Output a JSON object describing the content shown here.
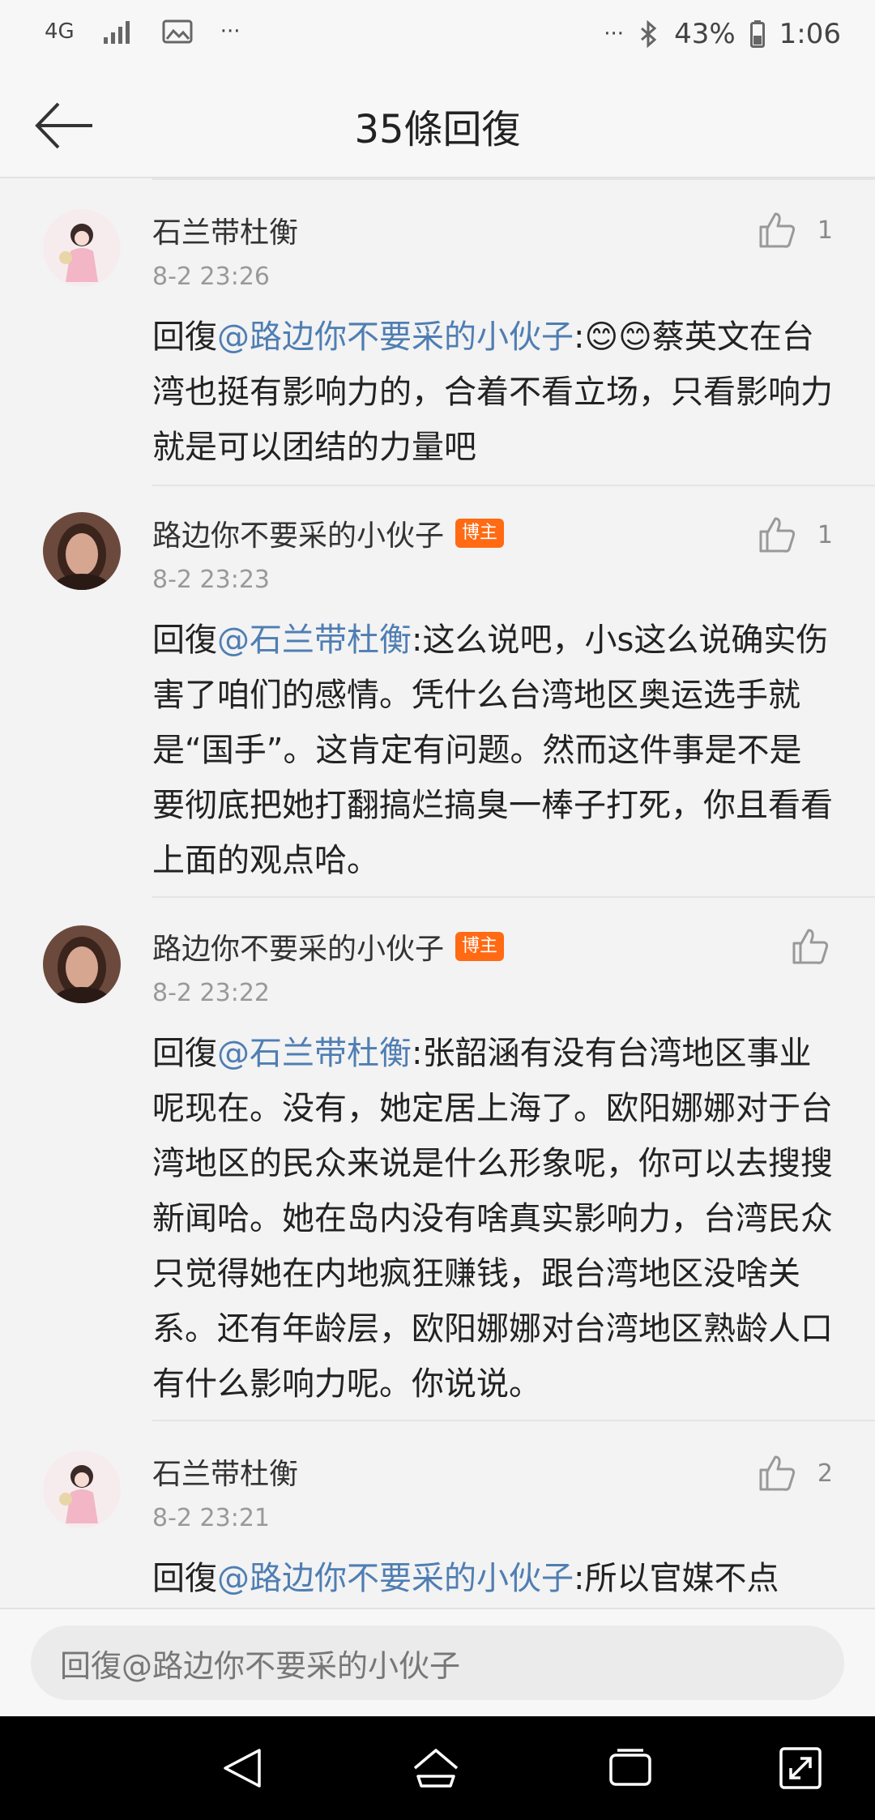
{
  "status_bar": {
    "network": "4G",
    "battery": "43%",
    "time": "1:06",
    "more": "···"
  },
  "header": {
    "title": "35條回復"
  },
  "comments": [
    {
      "author": "石兰带杜衡",
      "badge": "",
      "time": "8-2 23:26",
      "likes": "1",
      "reply_prefix": "回復",
      "mention": "@路边你不要采的小伙子",
      "text": ":😊😊蔡英文在台湾也挺有影响力的，合着不看立场，只看影响力就是可以团结的力量吧"
    },
    {
      "author": "路边你不要采的小伙子",
      "badge": "博主",
      "time": "8-2 23:23",
      "likes": "1",
      "reply_prefix": "回復",
      "mention": "@石兰带杜衡",
      "text": ":这么说吧，小s这么说确实伤害了咱们的感情。凭什么台湾地区奥运选手就是“国手”。这肯定有问题。然而这件事是不是要彻底把她打翻搞烂搞臭一棒子打死，你且看看上面的观点哈。"
    },
    {
      "author": "路边你不要采的小伙子",
      "badge": "博主",
      "time": "8-2 23:22",
      "likes": "",
      "reply_prefix": "回復",
      "mention": "@石兰带杜衡",
      "text": ":张韶涵有没有台湾地区事业呢现在。没有，她定居上海了。欧阳娜娜对于台湾地区的民众来说是什么形象呢，你可以去搜搜新闻哈。她在岛内没有啥真实影响力，台湾民众只觉得她在内地疯狂赚钱，跟台湾地区没啥关系。还有年龄层，欧阳娜娜对台湾地区熟龄人口有什么影响力呢。你说说。"
    },
    {
      "author": "石兰带杜衡",
      "badge": "",
      "time": "8-2 23:21",
      "likes": "2",
      "reply_prefix": "回復",
      "mention": "@路边你不要采的小伙子",
      "text": ":所以官媒不点"
    }
  ],
  "input": {
    "placeholder": "回復@路边你不要采的小伙子"
  },
  "colors": {
    "mention": "#4f7eb3",
    "badge": "#ff6a13",
    "background": "#f3f3f3"
  },
  "icons": [
    "signal-icon",
    "image-icon",
    "bluetooth-icon",
    "battery-icon",
    "back-arrow-icon",
    "like-thumb-icon",
    "nav-back-icon",
    "nav-home-icon",
    "nav-recents-icon",
    "nav-expand-icon"
  ]
}
